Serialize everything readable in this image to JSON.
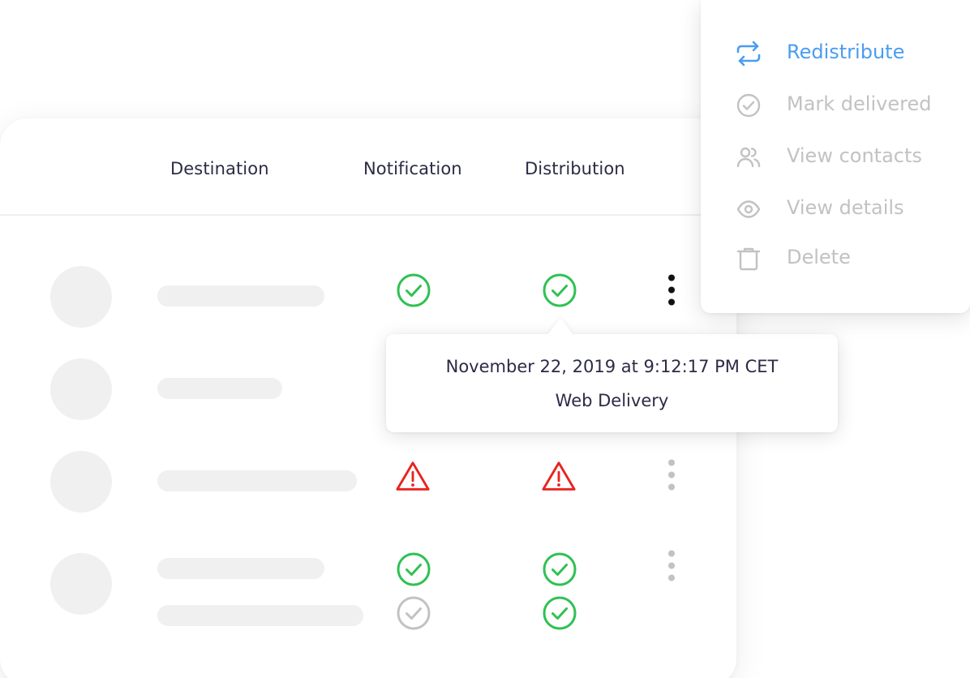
{
  "table": {
    "columns": {
      "destination": "Destination",
      "notification": "Notification",
      "distribution": "Distribution"
    },
    "rows": [
      {
        "notification_status": "delivered",
        "distribution_status": "delivered"
      },
      {
        "notification_status": "hidden",
        "distribution_status": "hidden"
      },
      {
        "notification_status": "error",
        "distribution_status": "error"
      },
      {
        "notification_status": [
          "delivered",
          "pending"
        ],
        "distribution_status": [
          "delivered",
          "delivered"
        ]
      }
    ]
  },
  "tooltip": {
    "timestamp": "November 22, 2019 at 9:12:17 PM CET",
    "method": "Web Delivery"
  },
  "menu": {
    "items": [
      {
        "label": "Redistribute",
        "icon": "redistribute-icon",
        "active": true
      },
      {
        "label": "Mark delivered",
        "icon": "check-circle-icon",
        "active": false
      },
      {
        "label": "View contacts",
        "icon": "contacts-icon",
        "active": false
      },
      {
        "label": "View details",
        "icon": "eye-icon",
        "active": false
      },
      {
        "label": "Delete",
        "icon": "trash-icon",
        "active": false
      }
    ]
  },
  "colors": {
    "success": "#2fc153",
    "error": "#e8231e",
    "muted": "#c2c2c2",
    "accent": "#4a9df0",
    "text": "#2b2b45",
    "placeholder": "#f0f0f0"
  }
}
